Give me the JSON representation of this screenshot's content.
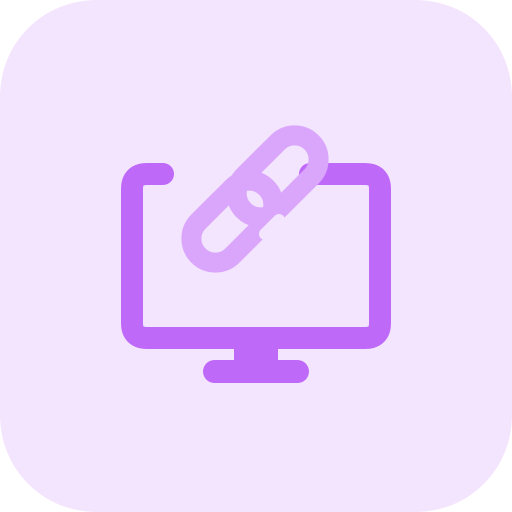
{
  "icon": {
    "name": "monitor-link-icon",
    "colors": {
      "background": "#F3E5FD",
      "monitor": "#BF69F9",
      "link": "#DAA6FB"
    }
  }
}
